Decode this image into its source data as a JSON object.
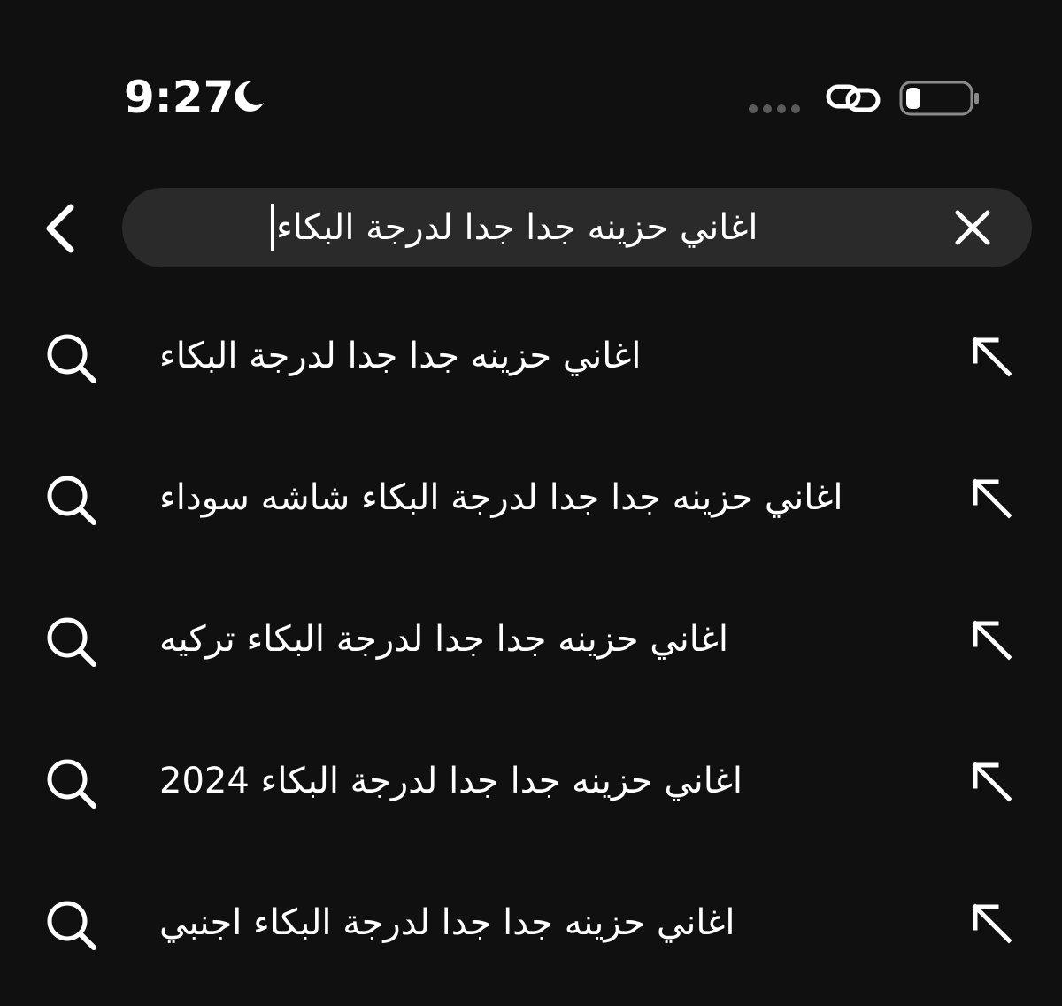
{
  "status_bar": {
    "time": "9:27",
    "moon_icon": "moon-icon",
    "link_icon": "link-icon",
    "battery_icon": "battery-low-icon"
  },
  "search": {
    "back_icon": "chevron-left-icon",
    "query": "اغاني حزينه جدا جدا لدرجة البكاء",
    "clear_icon": "close-icon"
  },
  "suggestions": [
    {
      "text": "اغاني حزينه جدا جدا لدرجة البكاء",
      "icon": "search-icon",
      "action_icon": "arrow-up-left-icon"
    },
    {
      "text": "اغاني حزينه جدا جدا لدرجة البكاء شاشه سوداء",
      "icon": "search-icon",
      "action_icon": "arrow-up-left-icon"
    },
    {
      "text": "اغاني حزينه جدا جدا لدرجة البكاء تركيه",
      "icon": "search-icon",
      "action_icon": "arrow-up-left-icon"
    },
    {
      "text": "اغاني حزينه جدا جدا لدرجة البكاء 2024",
      "icon": "search-icon",
      "action_icon": "arrow-up-left-icon"
    },
    {
      "text": "اغاني حزينه جدا جدا لدرجة البكاء اجنبي",
      "icon": "search-icon",
      "action_icon": "arrow-up-left-icon"
    }
  ],
  "colors": {
    "background": "#101010",
    "search_bar": "#2a2a2a",
    "text": "#ffffff",
    "dim": "#5a5a5a"
  }
}
